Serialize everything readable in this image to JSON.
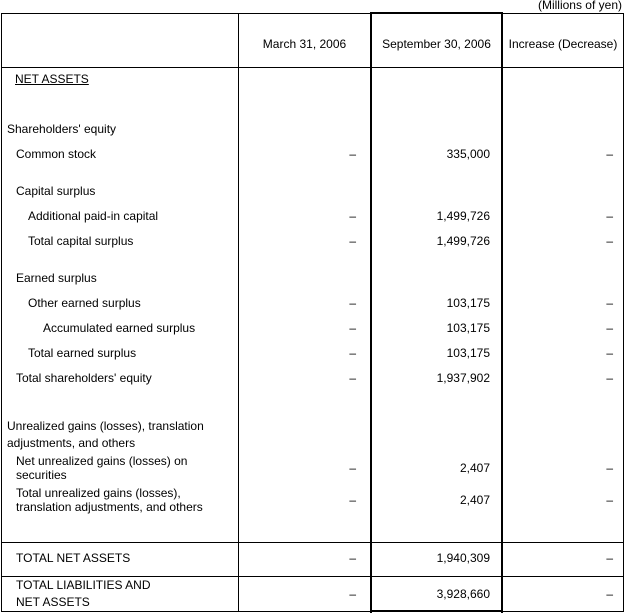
{
  "units_note": "(Millions of yen)",
  "header": {
    "col_label": "",
    "col_prev": "March 31, 2006",
    "col_curr": "September 30, 2006",
    "col_diff": "Increase (Decrease)"
  },
  "section_title": "NET ASSETS",
  "rows": [
    {
      "label": "Shareholders' equity",
      "prev": "",
      "curr": "",
      "diff": ""
    },
    {
      "label": "Common stock",
      "prev": "–",
      "curr": "335,000",
      "diff": "–"
    },
    {
      "label": "Capital surplus",
      "prev": "",
      "curr": "",
      "diff": ""
    },
    {
      "label": "Additional paid-in capital",
      "prev": "–",
      "curr": "1,499,726",
      "diff": "–"
    },
    {
      "label": "Total capital surplus",
      "prev": "–",
      "curr": "1,499,726",
      "diff": "–"
    },
    {
      "label": "Earned surplus",
      "prev": "",
      "curr": "",
      "diff": ""
    },
    {
      "label": "Other earned surplus",
      "prev": "–",
      "curr": "103,175",
      "diff": "–"
    },
    {
      "label": "Accumulated earned surplus",
      "prev": "–",
      "curr": "103,175",
      "diff": "–"
    },
    {
      "label": "Total earned surplus",
      "prev": "–",
      "curr": "103,175",
      "diff": "–"
    },
    {
      "label": "Total shareholders' equity",
      "prev": "–",
      "curr": "1,937,902",
      "diff": "–"
    },
    {
      "label": "Unrealized gains (losses), translation adjustments, and others",
      "prev": "",
      "curr": "",
      "diff": ""
    },
    {
      "label": "Net unrealized gains (losses) on securities",
      "prev": "–",
      "curr": "2,407",
      "diff": "–"
    },
    {
      "label": "Total unrealized gains (losses), translation adjustments, and others",
      "prev": "–",
      "curr": "2,407",
      "diff": "–"
    }
  ],
  "totals": [
    {
      "label": "TOTAL NET ASSETS",
      "prev": "–",
      "curr": "1,940,309",
      "diff": "–"
    },
    {
      "label": "TOTAL LIABILITIES AND NET ASSETS",
      "prev": "–",
      "curr": "3,928,660",
      "diff": "–"
    }
  ]
}
